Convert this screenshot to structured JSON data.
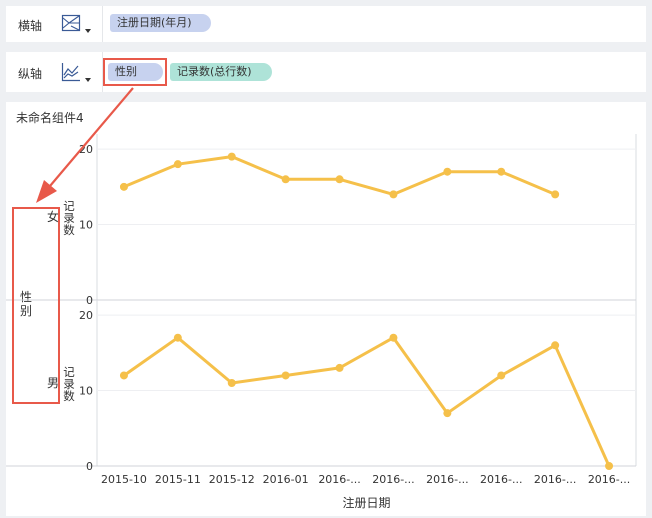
{
  "shelves": {
    "x": {
      "label": "横轴",
      "icon": "area-chart-icon",
      "fields": [
        {
          "label": "注册日期(年月)"
        }
      ]
    },
    "y": {
      "label": "纵轴",
      "icon": "line-chart-icon",
      "fields": [
        {
          "label": "性别"
        },
        {
          "label": "记录数(总行数)"
        }
      ]
    }
  },
  "widget": {
    "title": "未命名组件4"
  },
  "colors": {
    "line": "#f5c04a",
    "pill_blue": "#c7d2ef",
    "pill_green": "#aee3d8",
    "annotation": "#e8594a"
  },
  "chart_data": {
    "type": "line",
    "xlabel": "注册日期",
    "row_dimension": "性别",
    "ylabel": "记录数",
    "categories": [
      "2015-10",
      "2015-11",
      "2015-12",
      "2016-01",
      "2016-...",
      "2016-...",
      "2016-...",
      "2016-...",
      "2016-...",
      "2016-..."
    ],
    "ylim": [
      0,
      22
    ],
    "yticks": [
      0,
      10,
      20
    ],
    "grid": true,
    "panels": [
      {
        "label": "女",
        "values": [
          15,
          18,
          19,
          16,
          16,
          14,
          17,
          17,
          14,
          null
        ]
      },
      {
        "label": "男",
        "values": [
          12,
          17,
          11,
          12,
          13,
          17,
          7,
          12,
          16,
          0
        ]
      }
    ]
  }
}
